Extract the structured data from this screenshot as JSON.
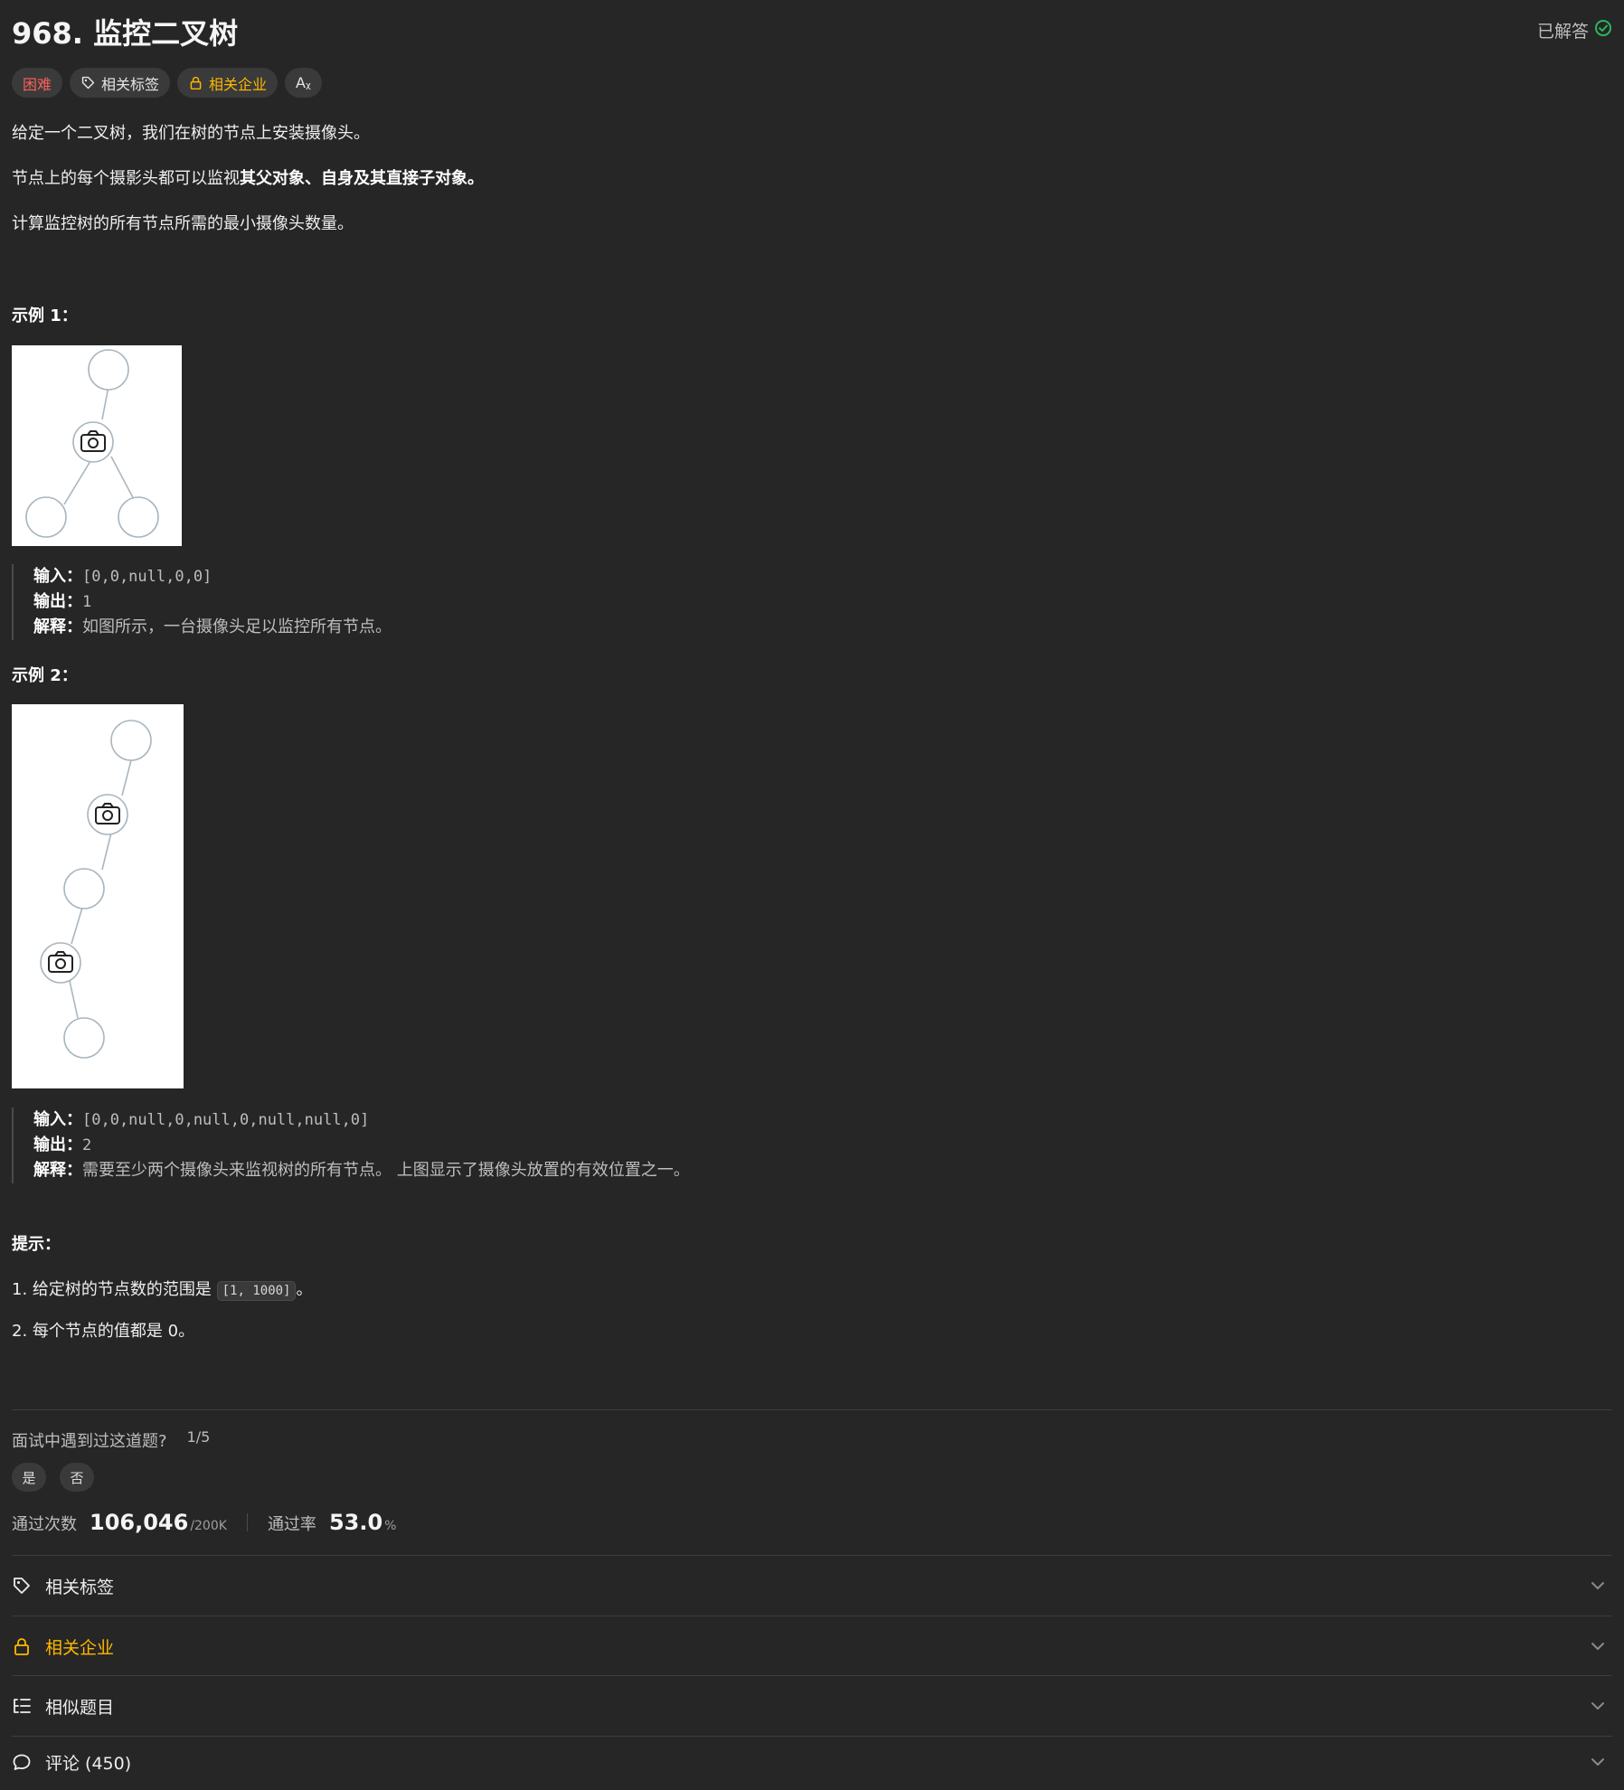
{
  "title": "968. 监控二叉树",
  "status": "已解答",
  "tags": {
    "difficulty": "困难",
    "topics": "相关标签",
    "companies": "相关企业",
    "translate": "Aᵪ"
  },
  "description": {
    "p1": "给定一个二叉树，我们在树的节点上安装摄像头。",
    "p2_prefix": "节点上的每个摄影头都可以监视",
    "p2_bold": "其父对象、自身及其直接子对象。",
    "p3": "计算监控树的所有节点所需的最小摄像头数量。"
  },
  "example1": {
    "heading": "示例 1：",
    "input_label": "输入：",
    "input": "[0,0,null,0,0]",
    "output_label": "输出：",
    "output": "1",
    "explain_label": "解释：",
    "explain": "如图所示，一台摄像头足以监控所有节点。"
  },
  "example2": {
    "heading": "示例 2：",
    "input_label": "输入：",
    "input": "[0,0,null,0,null,0,null,null,0]",
    "output_label": "输出：",
    "output": "2",
    "explain_label": "解释：",
    "explain": "需要至少两个摄像头来监视树的所有节点。 上图显示了摄像头放置的有效位置之一。"
  },
  "hints": {
    "heading": "提示：",
    "item1_prefix": "1. 给定树的节点数的范围是 ",
    "item1_code": "[1, 1000]",
    "item1_suffix": "。",
    "item2": "2. 每个节点的值都是 0。"
  },
  "interview": {
    "question": "面试中遇到过这道题?",
    "fraction": "1/5",
    "yes": "是",
    "no": "否"
  },
  "stats": {
    "accepted_label": "通过次数",
    "accepted": "106,046",
    "submissions": "/200K",
    "rate_label": "通过率",
    "rate": "53.0",
    "rate_unit": "%"
  },
  "accordion": {
    "topics": "相关标签",
    "companies": "相关企业",
    "similar": "相似题目",
    "comments": "评论 (450)"
  }
}
